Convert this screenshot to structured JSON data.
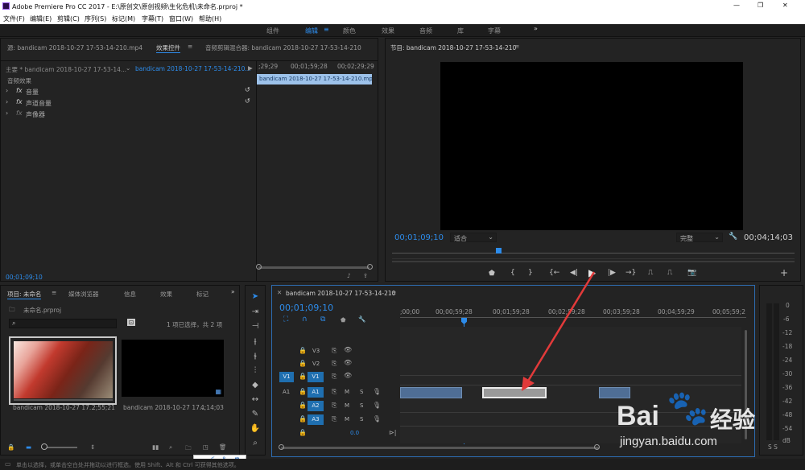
{
  "titlebar": {
    "title": "Adobe Premiere Pro CC 2017 - E:\\原创文\\原创视频\\生化危机\\未命名.prproj *",
    "minimize": "—",
    "restore": "❐",
    "close": "✕"
  },
  "menu": [
    "文件(F)",
    "编辑(E)",
    "剪辑(C)",
    "序列(S)",
    "标记(M)",
    "字幕(T)",
    "窗口(W)",
    "帮助(H)"
  ],
  "workspaces": [
    "组件",
    "编辑",
    "颜色",
    "效果",
    "音频",
    "库",
    "字幕"
  ],
  "ws_active": "编辑",
  "source_tabs": {
    "source": "源: bandicam 2018-10-27 17-53-14-210.mp4",
    "effects": "效果控件",
    "mixer": "音频剪辑混合器: bandicam 2018-10-27 17-53-14-210"
  },
  "ec": {
    "master": "主要 * bandicam 2018-10-27 17-53-14...",
    "clip": "bandicam 2018-10-27 17-53-14-210...",
    "ruler": [
      ";29;29",
      "00;01;59;28",
      "00;02;29;29"
    ],
    "bar_label": "bandicam 2018-10-27 17-53-14-210.mp4",
    "section": "音频效果",
    "effects": [
      "音量",
      "声道音量",
      "声像器"
    ],
    "timecode": "00;01;09;10"
  },
  "program": {
    "tab": "节目: bandicam 2018-10-27 17-53-14-210",
    "timecode": "00;01;09;10",
    "fit": "适合",
    "quality": "完整",
    "duration": "00;04;14;03"
  },
  "project": {
    "tabs": [
      "项目: 未命名",
      "媒体浏览器",
      "信息",
      "效果",
      "标记"
    ],
    "file": "未命名.prproj",
    "count": "1 项已选择，共 2 项",
    "items": [
      {
        "name": "bandicam 2018-10-27 17...",
        "dur": "2;55;21"
      },
      {
        "name": "bandicam 2018-10-27 17...",
        "dur": "4;14;03"
      }
    ]
  },
  "timeline": {
    "tab": "bandicam 2018-10-27 17-53-14-210",
    "timecode": "00;01;09;10",
    "ruler": [
      ";00;00",
      "00;00;59;28",
      "00;01;59;28",
      "00;02;59;28",
      "00;03;59;28",
      "00;04;59;29",
      "00;05;59;2"
    ],
    "video_tracks": [
      "V3",
      "V2",
      "V1"
    ],
    "audio_tracks": [
      "A1",
      "A2",
      "A3"
    ],
    "src_v": "V1",
    "src_a": "A1",
    "volume": "0.0"
  },
  "meter": {
    "scale": [
      "0",
      "-6",
      "-12",
      "-18",
      "-24",
      "-30",
      "-36",
      "-42",
      "-48",
      "-54",
      "dB"
    ],
    "solo": "S S"
  },
  "ime": {
    "label": "中"
  },
  "watermark": {
    "brand": "Bai",
    "sub": "经验",
    "url": "jingyan.baidu.com"
  },
  "status": "单击以选择，或单击空白处并拖动以进行框选。使用 Shift、Alt 和 Ctrl 可获得其他选项。"
}
